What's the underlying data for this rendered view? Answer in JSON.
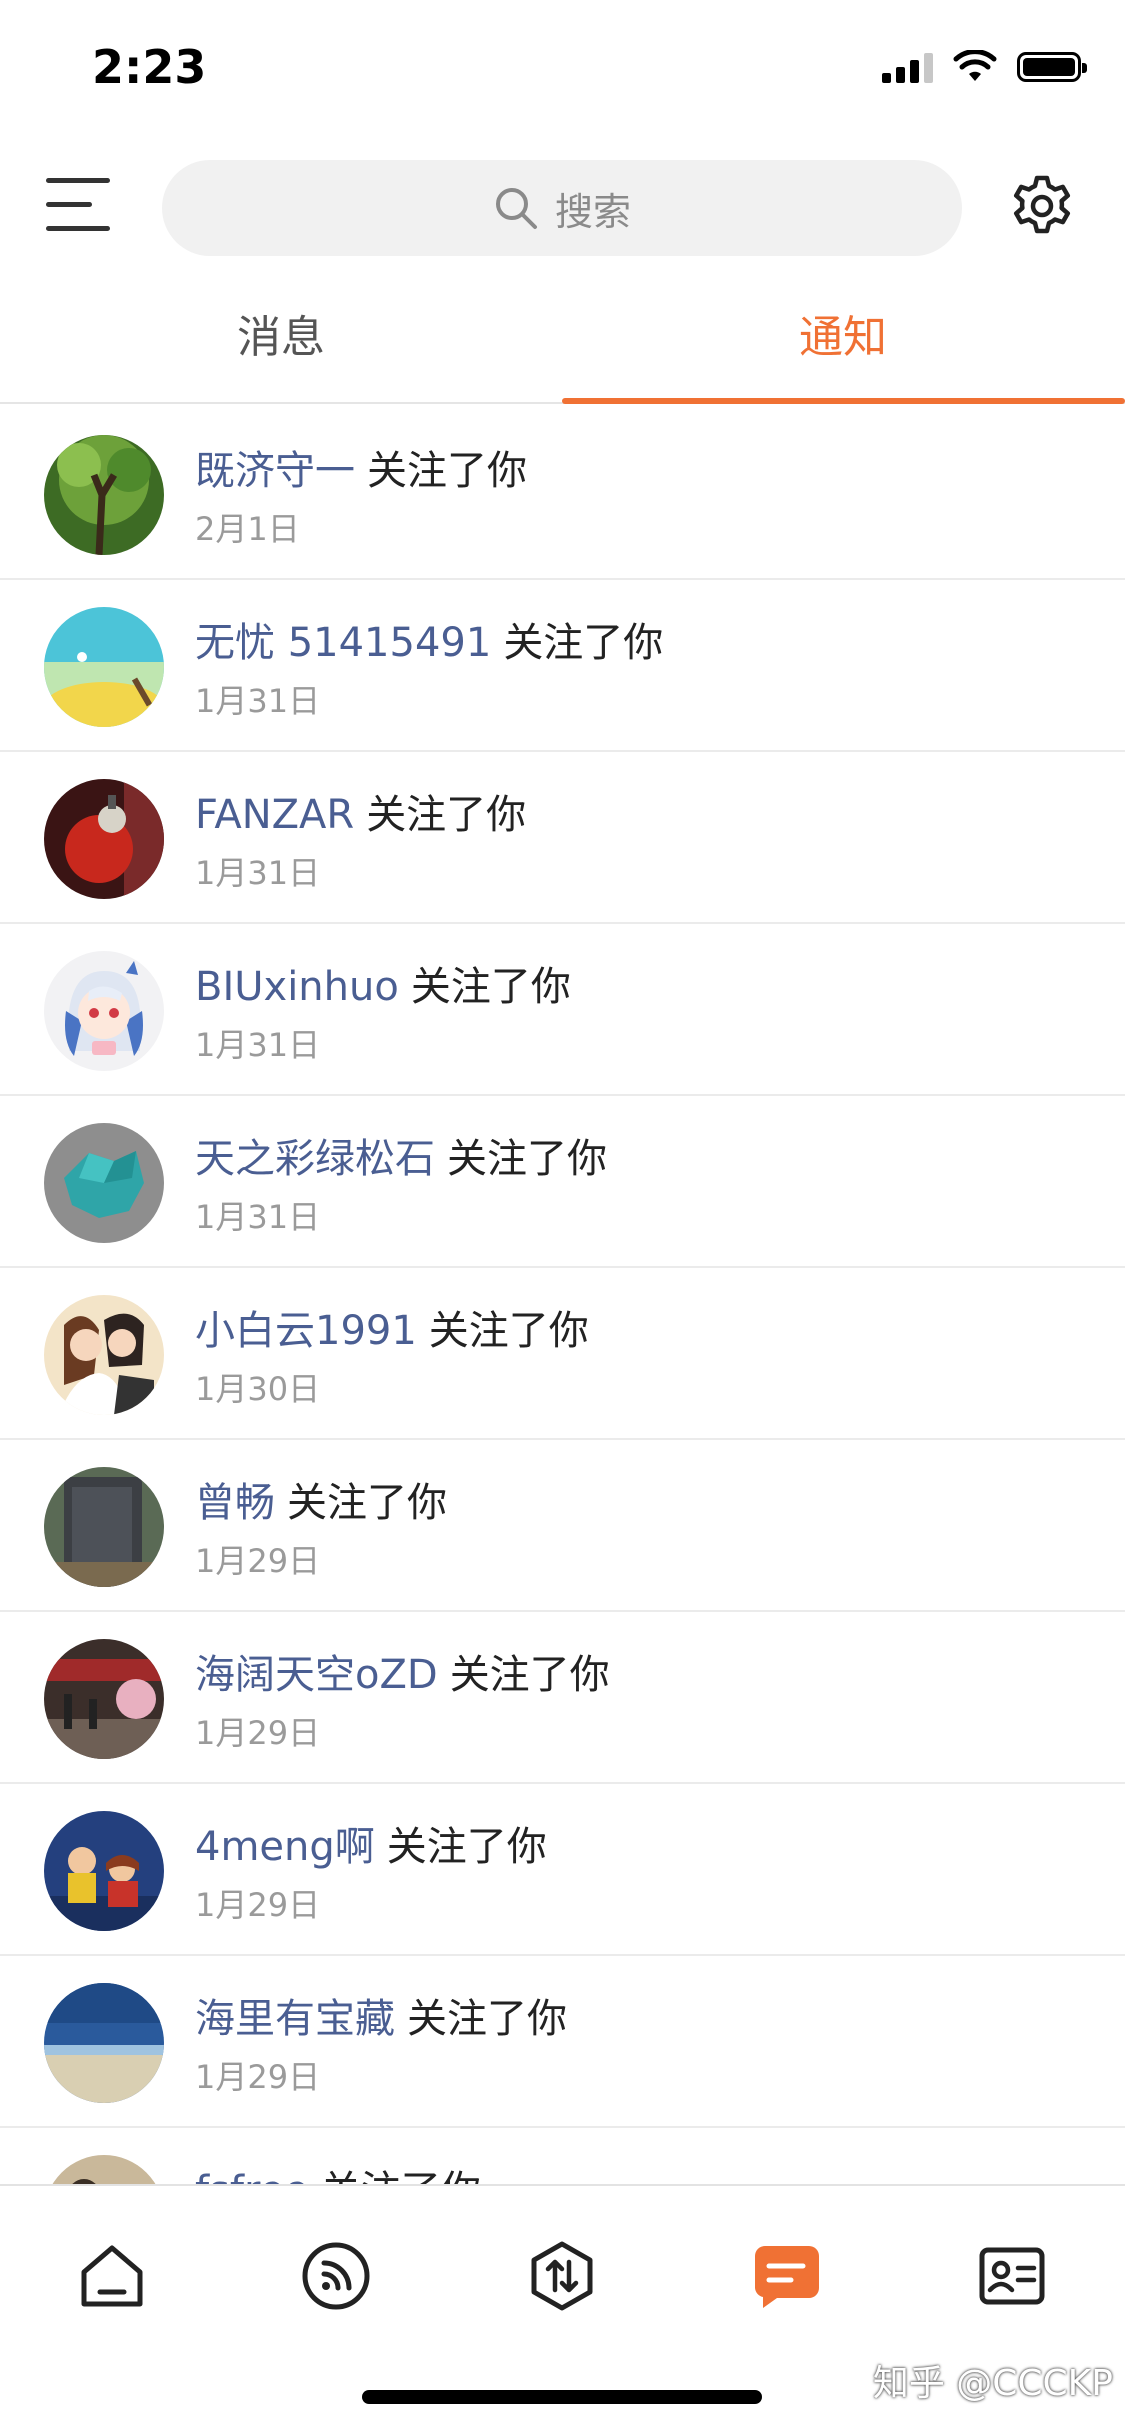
{
  "status_bar": {
    "time": "2:23"
  },
  "search": {
    "placeholder": "搜索"
  },
  "tabs": [
    {
      "label": "消息",
      "active": false
    },
    {
      "label": "通知",
      "active": true
    }
  ],
  "colors": {
    "accent": "#f07134",
    "username": "#4a5e92"
  },
  "notifications": [
    {
      "user": "既济守一",
      "action": "关注了你",
      "date": "2月1日",
      "avatar": "forest-tree"
    },
    {
      "user": "无忧 51415491",
      "action": "关注了你",
      "date": "1月31日",
      "avatar": "yellow-landscape"
    },
    {
      "user": "FANZAR",
      "action": "关注了你",
      "date": "1月31日",
      "avatar": "red-lantern"
    },
    {
      "user": "BIUxinhuo",
      "action": "关注了你",
      "date": "1月31日",
      "avatar": "anime-girl"
    },
    {
      "user": "天之彩绿松石",
      "action": "关注了你",
      "date": "1月31日",
      "avatar": "turquoise-stone"
    },
    {
      "user": "小白云1991",
      "action": "关注了你",
      "date": "1月30日",
      "avatar": "illustrated-couple"
    },
    {
      "user": "曾畅",
      "action": "关注了你",
      "date": "1月29日",
      "avatar": "stone-monument"
    },
    {
      "user": "海阔天空oZD",
      "action": "关注了你",
      "date": "1月29日",
      "avatar": "street-scene"
    },
    {
      "user": "4meng啊",
      "action": "关注了你",
      "date": "1月29日",
      "avatar": "kids-on-bench"
    },
    {
      "user": "海里有宝藏",
      "action": "关注了你",
      "date": "1月29日",
      "avatar": "ocean-beach"
    },
    {
      "user": "fsfree",
      "action": "关注了你",
      "date": "",
      "avatar": "abstract-pattern"
    }
  ],
  "tab_bar": [
    {
      "icon": "home-icon",
      "active": false
    },
    {
      "icon": "rss-icon",
      "active": false
    },
    {
      "icon": "exchange-icon",
      "active": false
    },
    {
      "icon": "message-icon",
      "active": true
    },
    {
      "icon": "contact-card-icon",
      "active": false
    }
  ],
  "watermark": "知乎 @CCCKP"
}
